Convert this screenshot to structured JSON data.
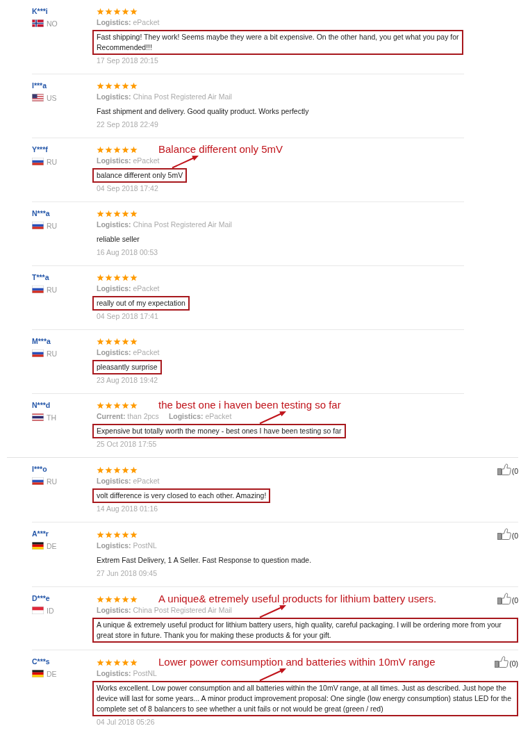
{
  "sections": [
    {
      "reviews": [
        {
          "name": "K***i",
          "flag": {
            "kind": "no"
          },
          "country": "NO",
          "stars": 5,
          "details": [
            "**Logistics:** ePacket"
          ],
          "comment": "Fast shipping! They work! Seems maybe they were a bit expensive. On the other hand, you get what you pay for\nRecommended!!!",
          "highlighted": true,
          "date": "17 Sep 2018 20:15"
        },
        {
          "name": "I***a",
          "flag": {
            "kind": "us"
          },
          "country": "US",
          "stars": 5,
          "details": [
            "**Logistics:** China Post Registered Air Mail"
          ],
          "comment": "Fast shipment and delivery. Good quality product. Works perfectly",
          "highlighted": false,
          "date": "22 Sep 2018 22:49"
        },
        {
          "name": "Y***f",
          "flag": {
            "kind": "ru"
          },
          "country": "RU",
          "stars": 5,
          "annotation": "Balance different only 5mV",
          "details": [
            "**Logistics:** ePacket"
          ],
          "comment": "balance different only 5mV",
          "highlighted": true,
          "date": "04 Sep 2018 17:42"
        },
        {
          "name": "N***a",
          "flag": {
            "kind": "ru"
          },
          "country": "RU",
          "stars": 5,
          "details": [
            "**Logistics:** China Post Registered Air Mail"
          ],
          "comment": "reliable seller",
          "highlighted": false,
          "date": "16 Aug 2018 00:53"
        },
        {
          "name": "T***a",
          "flag": {
            "kind": "ru"
          },
          "country": "RU",
          "stars": 5,
          "details": [
            "**Logistics:** ePacket"
          ],
          "comment": "really out of my expectation",
          "highlighted": true,
          "date": "04 Sep 2018 17:41"
        },
        {
          "name": "M***a",
          "flag": {
            "kind": "ru"
          },
          "country": "RU",
          "stars": 5,
          "details": [
            "**Logistics:** ePacket"
          ],
          "comment": "pleasantly surprise",
          "highlighted": true,
          "date": "23 Aug 2018 19:42"
        },
        {
          "name": "N***d",
          "flag": {
            "kind": "th"
          },
          "country": "TH",
          "stars": 5,
          "annotation": "the best one i haven been testing so far",
          "details": [
            "**Current:** than 2pcs",
            "**Logistics:** ePacket"
          ],
          "comment": "Expensive but totally worth the money - best ones I have been testing so far",
          "highlighted": true,
          "date": "25 Oct 2018 17:55"
        }
      ]
    },
    {
      "reviews": [
        {
          "name": "I***o",
          "flag": {
            "kind": "ru"
          },
          "country": "RU",
          "stars": 5,
          "likes": "(0",
          "details": [
            "**Logistics:** ePacket"
          ],
          "comment": "volt difference is very closed to each other. Amazing!",
          "highlighted": true,
          "date": "14 Aug 2018 01:16"
        },
        {
          "name": "A***r",
          "flag": {
            "kind": "de"
          },
          "country": "DE",
          "stars": 5,
          "likes": "(0",
          "details": [
            "**Logistics:** PostNL"
          ],
          "comment": "Extrem Fast Delivery, 1 A Seller. Fast Response to question made.",
          "highlighted": false,
          "date": "27 Jun 2018 09:45"
        },
        {
          "name": "D***e",
          "flag": {
            "kind": "id"
          },
          "country": "ID",
          "stars": 5,
          "annotation": "A unique& etremely useful products for lithium battery users.",
          "likes": "(0",
          "details": [
            "**Logistics:** China Post Registered Air Mail"
          ],
          "comment": "A unique & extremely useful product for lithium battery users, high quality, careful packaging. I will be ordering more from your great store in future. Thank you for making these products & for your gift.",
          "highlighted": true
        },
        {
          "name": "C***s",
          "flag": {
            "kind": "de"
          },
          "country": "DE",
          "stars": 5,
          "annotation": "Lower power comsumption and batteries within 10mV range",
          "likes": "(0)",
          "details": [
            "**Logistics:** PostNL"
          ],
          "comment": "Works excellent. Low power consumption and all batteries within the 10mV range, at all times. Just as described. Just hope the device will last for some years... A minor product improvement proposal: One single (low energy consumption) status LED for the complete set of 8 balancers to see whether a unit fails or not would be great (green / red)",
          "highlighted": true,
          "date": "04 Jul 2018 05:26"
        }
      ]
    }
  ]
}
